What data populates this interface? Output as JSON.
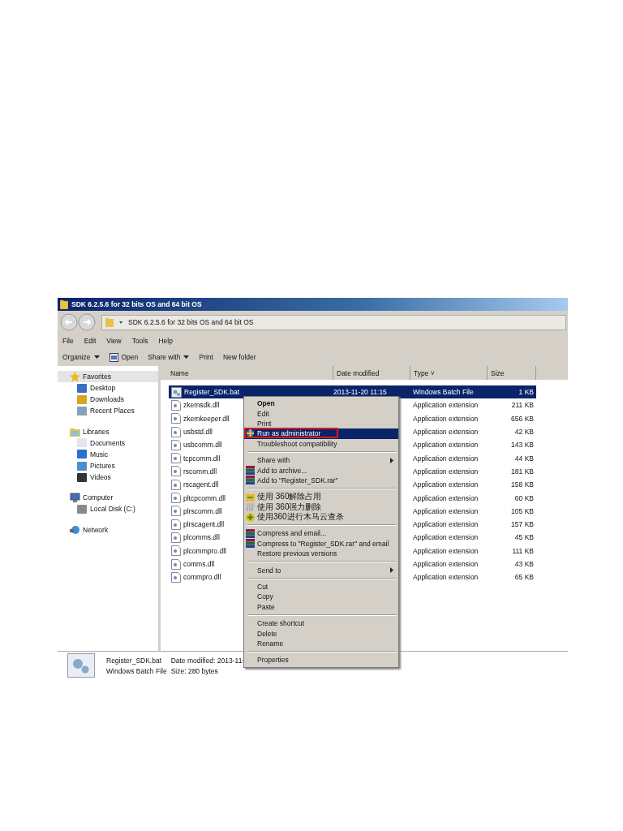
{
  "window": {
    "title": "SDK 6.2.5.6 for 32 bits OS and 64 bit OS"
  },
  "address": {
    "path": "SDK 6.2.5.6 for 32 bits OS and 64 bit OS"
  },
  "menu_bar": [
    "File",
    "Edit",
    "View",
    "Tools",
    "Help"
  ],
  "toolbar": [
    {
      "label": "Organize",
      "kind": "dropdown"
    },
    {
      "label": "Open",
      "kind": "icon"
    },
    {
      "label": "Share with",
      "kind": "dropdown"
    },
    {
      "label": "Print",
      "kind": "plain"
    },
    {
      "label": "New folder",
      "kind": "plain"
    }
  ],
  "sidebar": {
    "groups": [
      {
        "label": "Favorites",
        "kind": "star",
        "selected": true,
        "children": [
          {
            "label": "Desktop",
            "kind": "desktop",
            "selected": false
          },
          {
            "label": "Downloads",
            "kind": "download",
            "selected": false
          },
          {
            "label": "Recent Places",
            "kind": "recent",
            "selected": false
          }
        ]
      },
      {
        "label": "Libraries",
        "kind": "library",
        "selected": false,
        "children": [
          {
            "label": "Documents",
            "kind": "document",
            "selected": false
          },
          {
            "label": "Music",
            "kind": "music",
            "selected": false
          },
          {
            "label": "Pictures",
            "kind": "pictures",
            "selected": false
          },
          {
            "label": "Videos",
            "kind": "video",
            "selected": false
          }
        ]
      },
      {
        "label": "Computer",
        "kind": "computer",
        "selected": false,
        "children": [
          {
            "label": "Local Disk (C:)",
            "kind": "disk",
            "selected": false
          }
        ]
      },
      {
        "label": "Network",
        "kind": "network",
        "selected": false
      }
    ]
  },
  "table": {
    "columns": [
      "Name",
      "Date modified",
      "Type ˅",
      "Size"
    ],
    "rows": [
      {
        "name": "Register_SDK.bat",
        "date": "2013-11-20 11:15",
        "type": "Windows Batch File",
        "size": "1 KB",
        "kind": "batch",
        "selected": true
      },
      {
        "name": "zkemsdk.dll",
        "type": "Application extension",
        "size": "211 KB",
        "kind": "dll",
        "selected": false
      },
      {
        "name": "zkemkeeper.dll",
        "type": "Application extension",
        "size": "656 KB",
        "kind": "dll",
        "selected": false
      },
      {
        "name": "usbstd.dll",
        "type": "Application extension",
        "size": "42 KB",
        "kind": "dll",
        "selected": false
      },
      {
        "name": "usbcomm.dll",
        "type": "Application extension",
        "size": "143 KB",
        "kind": "dll",
        "selected": false
      },
      {
        "name": "tcpcomm.dll",
        "type": "Application extension",
        "size": "44 KB",
        "kind": "dll",
        "selected": false
      },
      {
        "name": "rscomm.dll",
        "type": "Application extension",
        "size": "181 KB",
        "kind": "dll",
        "selected": false
      },
      {
        "name": "rscagent.dll",
        "type": "Application extension",
        "size": "158 KB",
        "kind": "dll",
        "selected": false
      },
      {
        "name": "pltcpcomm.dll",
        "type": "Application extension",
        "size": "60 KB",
        "kind": "dll",
        "selected": false
      },
      {
        "name": "plrscomm.dll",
        "type": "Application extension",
        "size": "105 KB",
        "kind": "dll",
        "selected": false
      },
      {
        "name": "plrscagent.dll",
        "type": "Application extension",
        "size": "157 KB",
        "kind": "dll",
        "selected": false
      },
      {
        "name": "plcomms.dll",
        "type": "Application extension",
        "size": "45 KB",
        "kind": "dll",
        "selected": false
      },
      {
        "name": "plcommpro.dll",
        "type": "Application extension",
        "size": "111 KB",
        "kind": "dll",
        "selected": false
      },
      {
        "name": "comms.dll",
        "type": "Application extension",
        "size": "43 KB",
        "kind": "dll",
        "selected": false
      },
      {
        "name": "commpro.dll",
        "type": "Application extension",
        "size": "65 KB",
        "kind": "dll",
        "selected": false
      }
    ]
  },
  "context_menu": [
    {
      "label": "Open",
      "kind": "bold",
      "selected": false
    },
    {
      "label": "Edit",
      "kind": "plain",
      "selected": false
    },
    {
      "label": "Print",
      "kind": "plain",
      "selected": false
    },
    {
      "label": "Run as administrator",
      "kind": "shield",
      "selected": true
    },
    {
      "label": "Troubleshoot compatibility",
      "kind": "plain",
      "selected": false
    },
    {
      "kind": "separator"
    },
    {
      "label": "Share with",
      "kind": "submenu",
      "selected": false
    },
    {
      "label": "Add to archive...",
      "kind": "archive",
      "selected": false
    },
    {
      "label": "Add to \"Register_SDK.rar\"",
      "kind": "archive",
      "selected": false
    },
    {
      "kind": "separator"
    },
    {
      "label": "使用 360解除占用",
      "kind": "unlock",
      "selected": false
    },
    {
      "label": "使用 360强力删除",
      "kind": "shred",
      "selected": false
    },
    {
      "label": "使用360进行木马云查杀",
      "kind": "scan",
      "selected": false
    },
    {
      "kind": "separator"
    },
    {
      "label": "Compress and email...",
      "kind": "archive",
      "selected": false
    },
    {
      "label": "Compress to \"Register_SDK.rar\" and email",
      "kind": "archive",
      "selected": false
    },
    {
      "label": "Restore previous versions",
      "kind": "plain",
      "selected": false
    },
    {
      "kind": "separator"
    },
    {
      "label": "Send to",
      "kind": "submenu",
      "selected": false
    },
    {
      "kind": "separator"
    },
    {
      "label": "Cut",
      "kind": "plain",
      "selected": false
    },
    {
      "label": "Copy",
      "kind": "plain",
      "selected": false
    },
    {
      "label": "Paste",
      "kind": "plain",
      "selected": false
    },
    {
      "kind": "separator"
    },
    {
      "label": "Create shortcut",
      "kind": "plain",
      "selected": false
    },
    {
      "label": "Delete",
      "kind": "plain",
      "selected": false
    },
    {
      "label": "Rename",
      "kind": "plain",
      "selected": false
    },
    {
      "kind": "separator"
    },
    {
      "label": "Properties",
      "kind": "plain",
      "selected": false
    }
  ],
  "details": {
    "name": "Register_SDK.bat",
    "type": "Windows Batch File",
    "date_modified": "Date modified: 2013-11-",
    "size": "Size: 280 bytes"
  }
}
